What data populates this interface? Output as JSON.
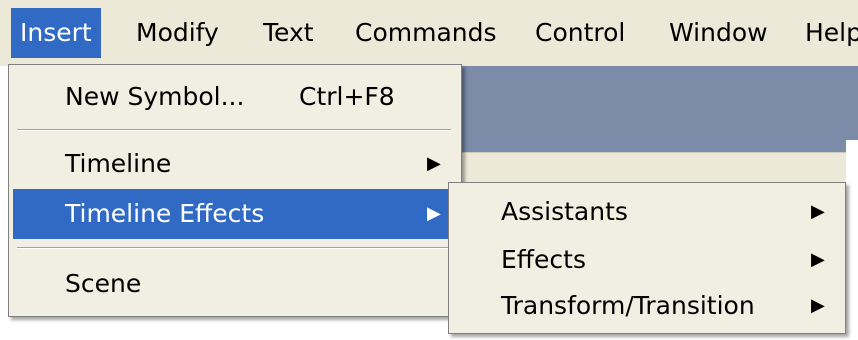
{
  "menubar": {
    "items": [
      {
        "label": "Insert"
      },
      {
        "label": "Modify"
      },
      {
        "label": "Text"
      },
      {
        "label": "Commands"
      },
      {
        "label": "Control"
      },
      {
        "label": "Window"
      },
      {
        "label": "Help"
      }
    ]
  },
  "insert_menu": {
    "new_symbol": {
      "label": "New Symbol...",
      "shortcut": "Ctrl+F8"
    },
    "timeline": {
      "label": "Timeline",
      "arrow": "▶"
    },
    "timeline_effects": {
      "label": "Timeline Effects",
      "arrow": "▶"
    },
    "scene": {
      "label": "Scene"
    }
  },
  "timeline_effects_submenu": {
    "items": [
      {
        "label": "Assistants",
        "arrow": "▶"
      },
      {
        "label": "Effects",
        "arrow": "▶"
      },
      {
        "label": "Transform/Transition",
        "arrow": "▶"
      }
    ]
  },
  "colors": {
    "menubar_bg": "#ece9d8",
    "highlight": "#316ac5",
    "menu_bg": "#f1efe2",
    "app_bg": "#7b8ba8"
  }
}
